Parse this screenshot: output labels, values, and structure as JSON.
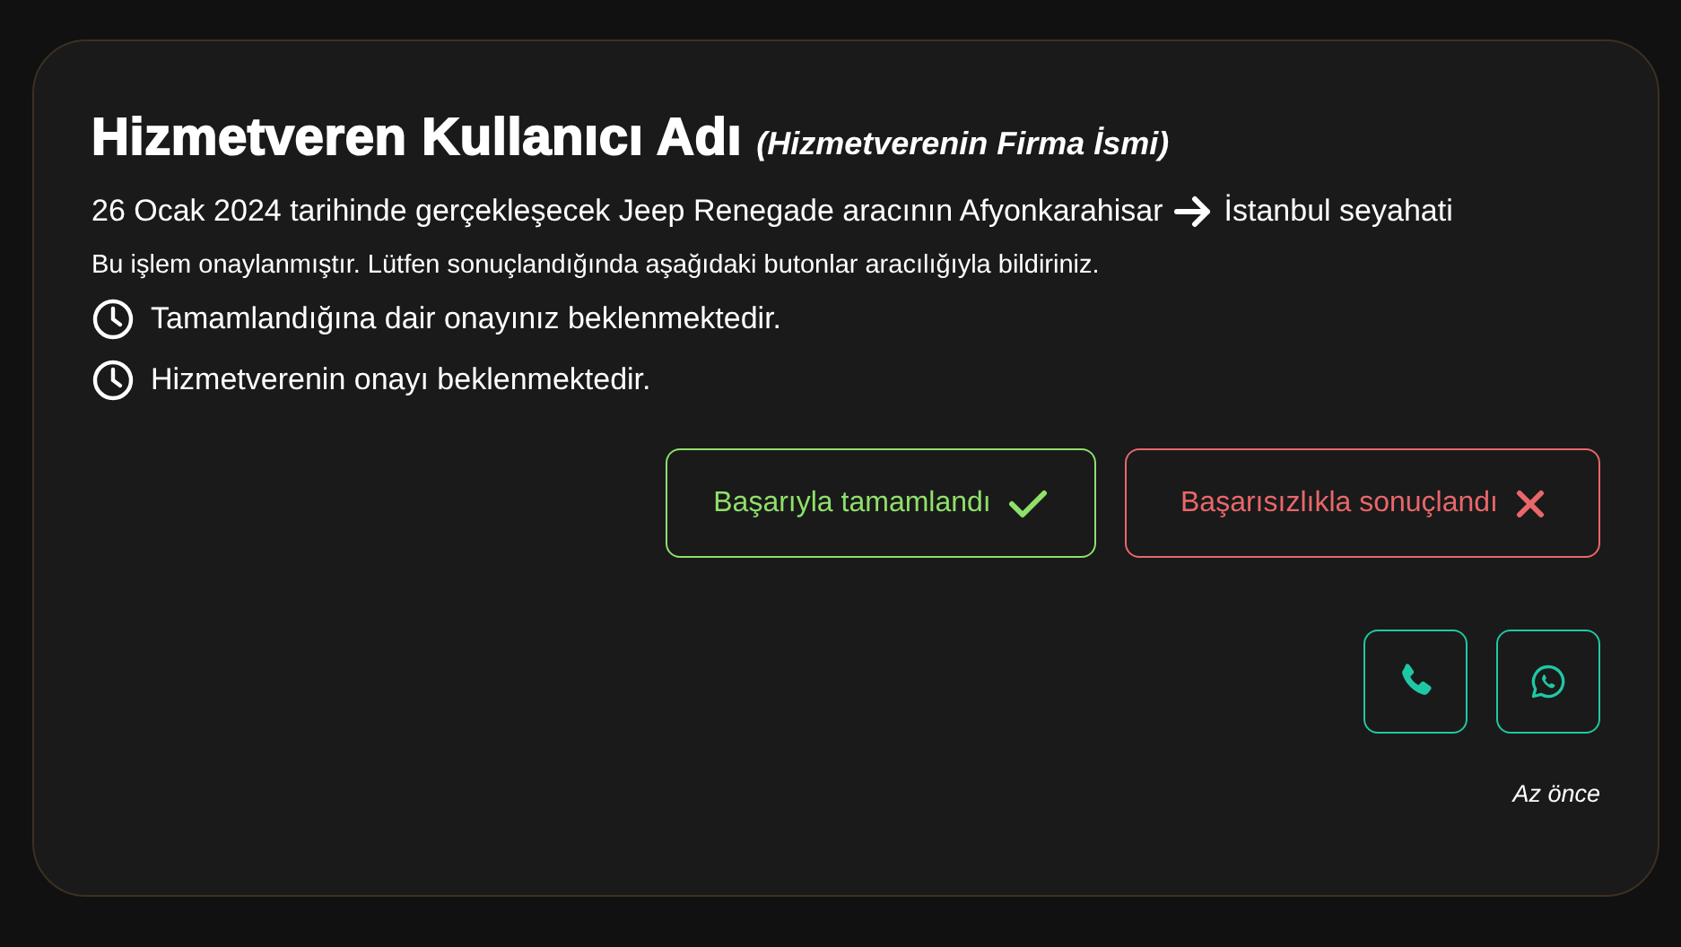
{
  "card": {
    "title": "Hizmetveren Kullanıcı Adı",
    "company": "(Hizmetverenin Firma İsmi)",
    "trip": {
      "start": "26 Ocak 2024 tarihinde gerçekleşecek Jeep Renegade aracının Afyonkarahisar",
      "end": "İstanbul seyahati"
    },
    "notice": "Bu işlem onaylanmıştır. Lütfen sonuçlandığında aşağıdaki butonlar aracılığıyla bildiriniz.",
    "statuses": [
      "Tamamlandığına dair onayınız beklenmektedir.",
      "Hizmetverenin onayı beklenmektedir."
    ],
    "actions": [
      {
        "kind": "success",
        "label": "Başarıyla tamamlandı"
      },
      {
        "kind": "failure",
        "label": "Başarısızlıkla sonuçlandı"
      }
    ],
    "contacts": [
      {
        "kind": "phone"
      },
      {
        "kind": "whatsapp"
      }
    ],
    "time": "Az önce"
  }
}
